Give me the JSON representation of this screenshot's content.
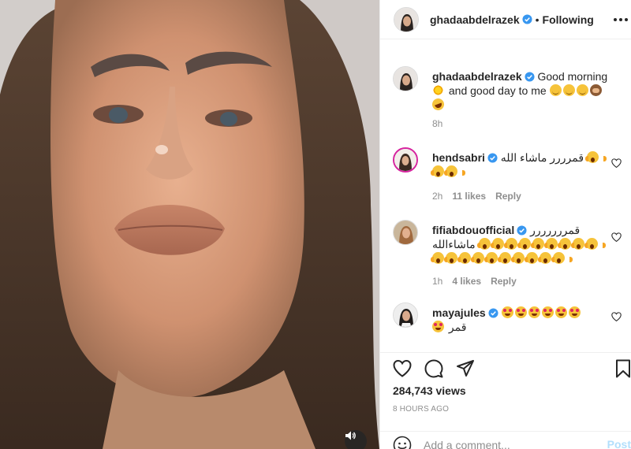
{
  "header": {
    "username": "ghadaabdelrazek",
    "separator": "•",
    "follow_state": "Following"
  },
  "caption": {
    "username": "ghadaabdelrazek",
    "text_line1": "Good morning",
    "text_line2": "and good day to me",
    "time": "8h"
  },
  "comments": [
    {
      "username": "hendsabri",
      "text": "قمرررر ماشاء الله",
      "time": "2h",
      "likes": "11 likes",
      "reply": "Reply"
    },
    {
      "username": "fifiabdouofficial",
      "text_line1": "قمررررررر",
      "text_line2": "ماشاءالله",
      "time": "1h",
      "likes": "4 likes",
      "reply": "Reply"
    },
    {
      "username": "mayajules",
      "text": "قمر"
    }
  ],
  "stats": {
    "views": "284,743 views",
    "time_ago": "8 HOURS AGO"
  },
  "add_comment": {
    "placeholder": "Add a comment...",
    "post_label": "Post"
  },
  "icons": {
    "verified": "verified-badge-icon",
    "like": "heart-icon",
    "comment": "comment-icon",
    "share": "share-icon",
    "save": "bookmark-icon",
    "more": "more-options-icon",
    "emoji": "emoji-icon",
    "mute": "speaker-icon"
  },
  "colors": {
    "verified_blue": "#3897f0",
    "post_disabled": "#b2dffc",
    "meta_gray": "#8e8e8e"
  }
}
